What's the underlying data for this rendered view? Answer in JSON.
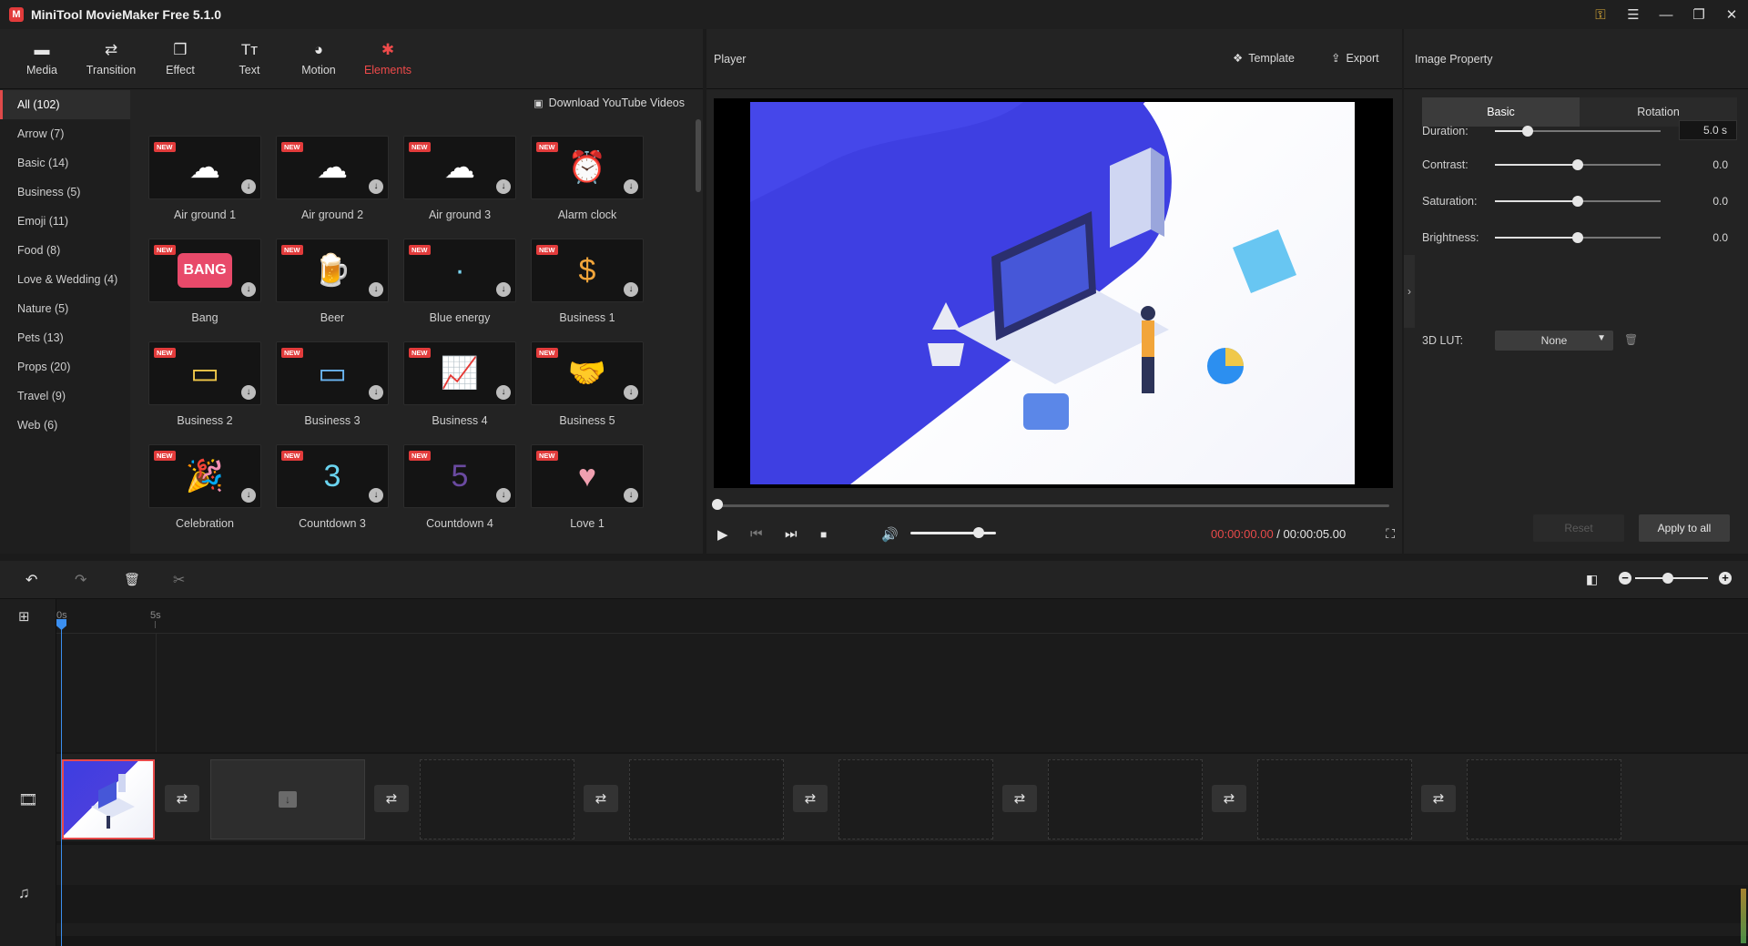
{
  "app": {
    "title": "MiniTool MovieMaker Free 5.1.0",
    "logo_glyph": "M",
    "controls": {
      "key": "⚿",
      "menu": "☰",
      "minimize": "—",
      "maximize": "❐",
      "close": "✕"
    }
  },
  "toolbar": {
    "tabs": [
      {
        "label": "Media",
        "icon": "folder-icon",
        "glyph": "▬"
      },
      {
        "label": "Transition",
        "icon": "swap-icon",
        "glyph": "⇄"
      },
      {
        "label": "Effect",
        "icon": "layers-icon",
        "glyph": "❒"
      },
      {
        "label": "Text",
        "icon": "text-icon",
        "glyph": "Tт"
      },
      {
        "label": "Motion",
        "icon": "motion-icon",
        "glyph": "◕"
      },
      {
        "label": "Elements",
        "icon": "elements-icon",
        "glyph": "✱"
      }
    ],
    "active": "Elements"
  },
  "categories": [
    "All (102)",
    "Arrow (7)",
    "Basic (14)",
    "Business (5)",
    "Emoji (11)",
    "Food (8)",
    "Love & Wedding (4)",
    "Nature (5)",
    "Pets (13)",
    "Props (20)",
    "Travel (9)",
    "Web (6)"
  ],
  "active_category": "All (102)",
  "download_link": "Download YouTube Videos",
  "elements": {
    "badge": "NEW",
    "download_glyph": "↓",
    "items": [
      {
        "label": "Air ground 1",
        "glyph": "☁"
      },
      {
        "label": "Air ground 2",
        "glyph": "☁"
      },
      {
        "label": "Air ground 3",
        "glyph": "☁"
      },
      {
        "label": "Alarm clock",
        "glyph": "⏰"
      },
      {
        "label": "Bang",
        "glyph": "BANG"
      },
      {
        "label": "Beer",
        "glyph": "🍺"
      },
      {
        "label": "Blue energy",
        "glyph": "·"
      },
      {
        "label": "Business 1",
        "glyph": "$"
      },
      {
        "label": "Business 2",
        "glyph": "▭"
      },
      {
        "label": "Business 3",
        "glyph": "▭"
      },
      {
        "label": "Business 4",
        "glyph": "📈"
      },
      {
        "label": "Business 5",
        "glyph": "🤝"
      },
      {
        "label": "Celebration",
        "glyph": "🎉"
      },
      {
        "label": "Countdown 3",
        "glyph": "3"
      },
      {
        "label": "Countdown 4",
        "glyph": "5"
      },
      {
        "label": "Love 1",
        "glyph": "♥"
      }
    ]
  },
  "player": {
    "title": "Player",
    "template_label": "Template",
    "export_label": "Export",
    "time_current": "00:00:00.00",
    "time_separator": " / ",
    "time_total": "00:00:05.00",
    "progress_fraction": 0.0,
    "volume_fraction": 0.8,
    "controls": {
      "play": "▶",
      "prev": "⏮",
      "next": "⏭",
      "stop": "■",
      "volume": "🔊",
      "fullscreen": "⛶"
    }
  },
  "properties": {
    "title": "Image Property",
    "tabs": [
      "Basic",
      "Rotation"
    ],
    "active_tab": "Basic",
    "rows": [
      {
        "label": "Duration:",
        "value": "5.0 s",
        "fraction": 0.2
      },
      {
        "label": "Contrast:",
        "value": "0.0",
        "fraction": 0.5
      },
      {
        "label": "Saturation:",
        "value": "0.0",
        "fraction": 0.5
      },
      {
        "label": "Brightness:",
        "value": "0.0",
        "fraction": 0.5
      }
    ],
    "lut_label": "3D LUT:",
    "lut_value": "None",
    "reset_label": "Reset",
    "apply_label": "Apply to all",
    "collapse_glyph": "›"
  },
  "timeline": {
    "tools": {
      "undo": "↶",
      "redo": "↷",
      "delete": "🗑",
      "cut": "✂",
      "add_track": "⊞",
      "split_audio": "◧"
    },
    "ruler": [
      {
        "label": "0s"
      },
      {
        "label": "5s"
      }
    ],
    "track_icons": {
      "video": "🎞",
      "audio": "♫"
    },
    "slots_empty": 7,
    "transition_glyph": "⇄",
    "drop_glyph": "↓",
    "zoom_fraction": 0.45
  },
  "colors": {
    "accent": "#e84a4a",
    "playhead": "#3b8ff0",
    "panel": "#232323"
  }
}
